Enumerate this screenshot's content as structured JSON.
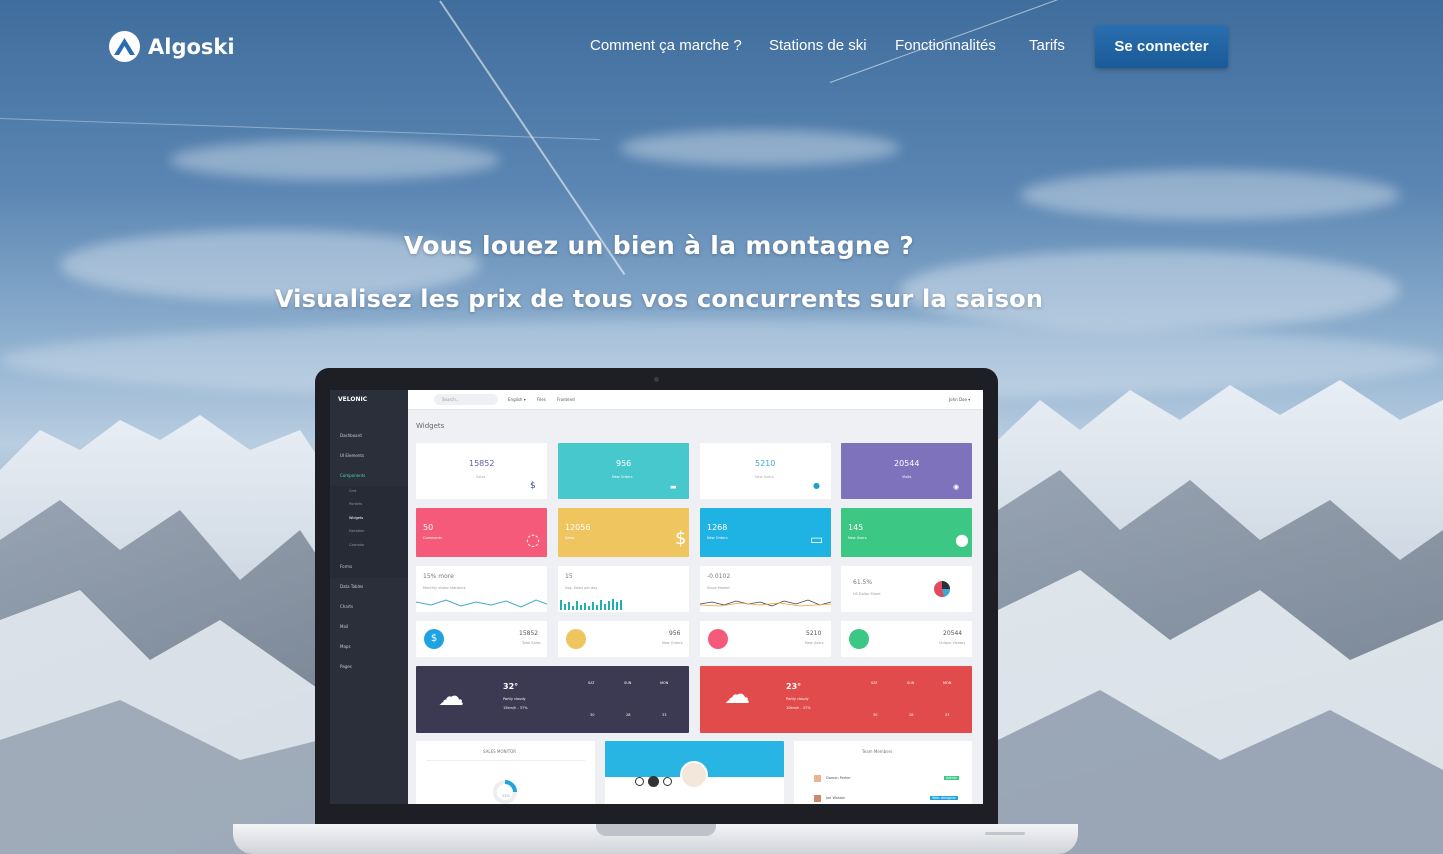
{
  "brand": {
    "name": "Algoski"
  },
  "nav": {
    "links": [
      "Comment ça marche ?",
      "Stations de ski",
      "Fonctionnalités",
      "Tarifs"
    ],
    "cta": "Se connecter"
  },
  "hero": {
    "title": "Vous louez un bien à la montagne ?",
    "subtitle": "Visualisez les prix de tous vos concurrents sur la saison"
  },
  "dashboard": {
    "brand": "VELONIC",
    "search_placeholder": "Search...",
    "topbar_links": [
      "English ▾",
      "Files",
      "Frontend"
    ],
    "user": "John Doe ▾",
    "section_title": "Widgets",
    "sidebar": [
      "Dashboard",
      "UI Elements",
      "Components",
      "Forms",
      "Data Tables",
      "Charts",
      "Mail",
      "Maps",
      "Pages"
    ],
    "sidebar_sub": [
      "Grid",
      "Portlets",
      "Widgets",
      "Nestable",
      "Calendar"
    ],
    "row1": [
      {
        "value": "15852",
        "label": "Sales",
        "icon": "$"
      },
      {
        "value": "956",
        "label": "New Orders",
        "icon": "🛒"
      },
      {
        "value": "5210",
        "label": "New Users",
        "icon": "👤"
      },
      {
        "value": "20544",
        "label": "Visits",
        "icon": "👁"
      }
    ],
    "row2": [
      {
        "value": "50",
        "label": "Comments"
      },
      {
        "value": "12056",
        "label": "Sales"
      },
      {
        "value": "1268",
        "label": "New Orders"
      },
      {
        "value": "145",
        "label": "New Users"
      }
    ],
    "row3": [
      {
        "value": "15% more",
        "label": "Monthly visitor statistics"
      },
      {
        "value": "15",
        "label": "Avg. Sales per day"
      },
      {
        "value": "-0.0102",
        "label": "Stock Market"
      },
      {
        "value": "61.5%",
        "label": "US Dollar Share"
      }
    ],
    "row4": [
      {
        "value": "15852",
        "label": "Total Sales"
      },
      {
        "value": "956",
        "label": "New Orders"
      },
      {
        "value": "5210",
        "label": "New Users"
      },
      {
        "value": "20544",
        "label": "Unique Visitors"
      }
    ],
    "weather": [
      {
        "temp": "32°",
        "desc": "Partly cloudy",
        "wind": "15km/h - 37%",
        "days": [
          "SAT",
          "SUN",
          "MON"
        ],
        "temps": [
          "30",
          "28",
          "33"
        ]
      },
      {
        "temp": "23°",
        "desc": "Partly cloudy",
        "wind": "10km/h - 37%",
        "days": [
          "SAT",
          "SUN",
          "MON"
        ],
        "temps": [
          "30",
          "28",
          "33"
        ]
      }
    ],
    "bottom": {
      "sales_monitor": "SALES MONITOR",
      "gauge_value": "22%",
      "team_title": "Team Members",
      "members": [
        {
          "name": "Damon Parker",
          "badge": "Admin"
        },
        {
          "name": "Joe Waston",
          "badge": "Web designer"
        }
      ]
    }
  }
}
